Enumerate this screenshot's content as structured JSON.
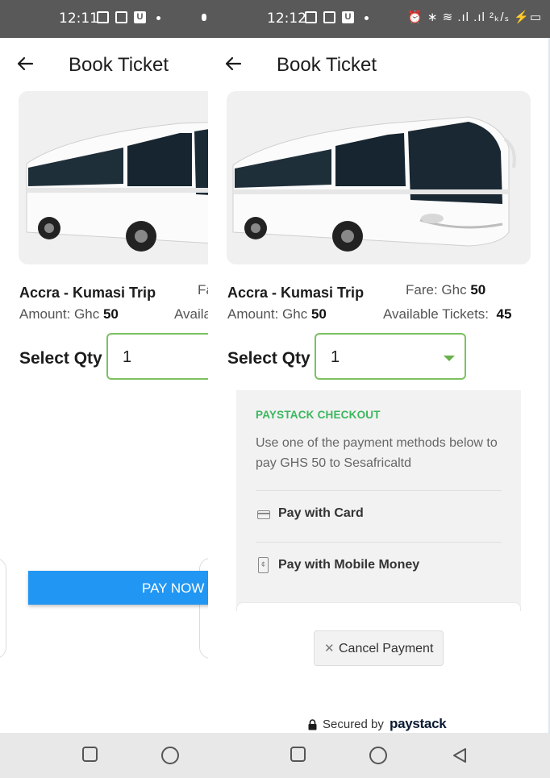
{
  "status_bar": {
    "left_time": "12:11",
    "right_time": "12:12",
    "right_icons": "⏰ ∗ ≋ .ıl .ıl ²ₖ/ₛ ⚡▭",
    "app_badge": "U"
  },
  "left_screen": {
    "title": "Book Ticket",
    "trip_name": "Accra - Kumasi Trip",
    "fare_partial": "Fa",
    "amount_label": "Amount: Ghc",
    "amount_value": "50",
    "available_partial": "Availa",
    "select_qty_label": "Select Qty",
    "qty_value": "1",
    "pay_now_label": "PAY NOW"
  },
  "right_screen": {
    "title": "Book Ticket",
    "trip_name": "Accra - Kumasi Trip",
    "fare_label": "Fare: Ghc",
    "fare_value": "50",
    "amount_label": "Amount: Ghc",
    "amount_value": "50",
    "available_label": "Available Tickets:",
    "available_value": "45",
    "select_qty_label": "Select Qty",
    "qty_value": "1"
  },
  "paystack": {
    "heading": "PAYSTACK CHECKOUT",
    "description": "Use one of the payment methods below to pay GHS 50 to Sesafricaltd",
    "options": [
      {
        "label": "Pay with Card",
        "icon": "credit-card-icon"
      },
      {
        "label": "Pay with Mobile Money",
        "icon": "mobile-money-icon"
      }
    ],
    "cancel_label": "Cancel Payment",
    "secured_text": "Secured by",
    "brand": "paystack"
  },
  "colors": {
    "status_bar": "#595959",
    "accent_green": "#3bb75e",
    "qty_border": "#7dc160",
    "pay_now_blue": "#2196f3",
    "panel_bg": "#f2f2f2",
    "nav_bar": "#e8e8e8"
  }
}
